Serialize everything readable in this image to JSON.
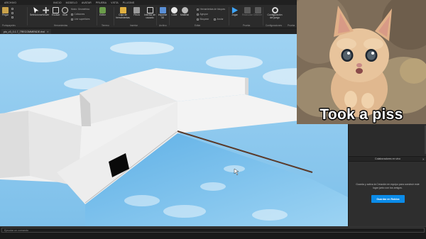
{
  "menu": {
    "items": [
      "ARCHIVO",
      "",
      "",
      "",
      "INICIO",
      "MODELO",
      "AVATAR",
      "PRUEBA",
      "VISTA",
      "PLUGINS"
    ],
    "active_index": 4
  },
  "ribbon": {
    "buttons": {
      "paste": "Pegar",
      "select": "Seleccionar",
      "move": "Mover",
      "scale": "Escalar",
      "rotate": "Girar",
      "editor": "Editor",
      "toolbox": "Caja de herramientas",
      "part": "Pieza",
      "ui": "Interfaz de usuario",
      "import3d": "Importar 3D",
      "color": "Color",
      "material": "Material",
      "play": "Jugar",
      "resume": "Reanudar",
      "stop": "Detener",
      "game_settings": "Configuración del juego"
    },
    "small": {
      "mode_label": "Modo:",
      "mode_value": "Geométrico",
      "collisions": "Colisiones",
      "join_surfaces": "Unir superficies",
      "tools": "Herramientas de bloques",
      "group": "Agrupar",
      "lock": "Bloquear",
      "anchor": "Anclar"
    },
    "groups": {
      "clipboard": "Portapapeles",
      "tools": "Herramientas",
      "terrain": "Terreno",
      "insert": "Insertar",
      "file": "Archivo",
      "edit": "Editar",
      "test": "Prueba",
      "settings": "Configuraciones",
      "team": "Prueba"
    }
  },
  "file_tab": {
    "name": "pio_v3_0.1.7_TRECOMMENDE.rbxl",
    "close": "✕"
  },
  "overlay": {
    "caption": "Took a piss"
  },
  "collab": {
    "title": "Colaboradores en vivo",
    "close": "✕",
    "text": "Guarda y activa la Creación en equipo para construir este lugar junto con tus amigos.",
    "button": "Guardar en Roblox"
  },
  "command": {
    "placeholder": "Ejecutar un comando"
  },
  "colors": {
    "accent": "#0b8be8",
    "sky": "#86c6ec",
    "floor": "#ebebeb",
    "water": "#7cc4f0"
  },
  "icons": [
    "paste-icon",
    "select-icon",
    "move-icon",
    "scale-icon",
    "rotate-icon",
    "editor-icon",
    "toolbox-icon",
    "part-icon",
    "ui-icon",
    "import-icon",
    "color-icon",
    "material-icon",
    "play-icon",
    "resume-icon",
    "stop-icon",
    "settings-icon"
  ]
}
